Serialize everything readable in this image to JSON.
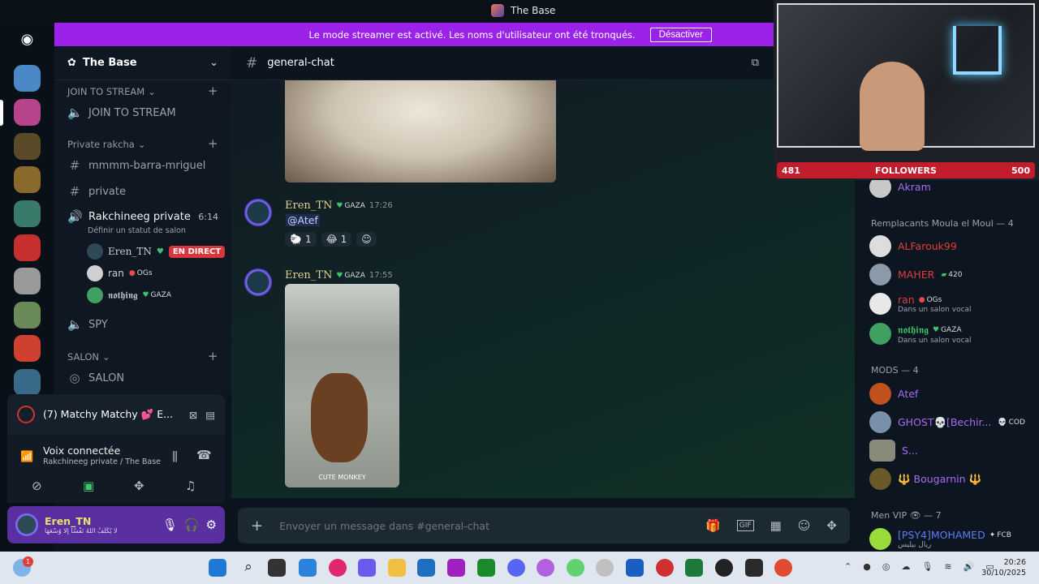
{
  "window": {
    "title": "The Base"
  },
  "banner": {
    "text": "Le mode streamer est activé. Les noms d'utilisateur ont été tronqués.",
    "button": "Désactiver"
  },
  "guild": {
    "name": "The Base"
  },
  "categories": {
    "join": "JOIN TO STREAM",
    "private": "Private rakcha",
    "salon": "SALON"
  },
  "channels": {
    "join_to_stream": "JOIN TO STREAM",
    "ch1": "mmmm-barra-mriguel",
    "ch2": "private",
    "voice_active": "Rakchineeg private",
    "voice_time": "6:14",
    "voice_status": "Définir un statut de salon",
    "spy": "SPY",
    "salon": "SALON"
  },
  "voice_users": [
    {
      "name": "Eren_TN",
      "badge": "EN DIRECT"
    },
    {
      "name": "ran",
      "tag": "OGs"
    },
    {
      "name": "𝖓𝖔𝖙𝖍𝖎𝖓𝖌",
      "tag": "GAZA"
    }
  ],
  "call": {
    "label": "(7) Matchy Matchy 💕 E..."
  },
  "voice_panel": {
    "status": "Voix connectée",
    "location": "Rakchineeg private / The Base"
  },
  "user": {
    "name": "Eren_TN",
    "status": "لَا يُكَلِّفُ اللَّهُ نَفْسًا إِلَّا وُسْعَهَا"
  },
  "chat": {
    "channel": "general-chat",
    "messages": [
      {
        "author": "Eren_TN",
        "tag": "GAZA",
        "time": "17:26",
        "text": "@Atef",
        "reactions": [
          {
            "emoji": "🐑",
            "count": "1"
          },
          {
            "emoji": "😂",
            "count": "1"
          }
        ]
      },
      {
        "author": "Eren_TN",
        "tag": "GAZA",
        "time": "17:55",
        "image_caption": "CUTE MONKEY"
      }
    ],
    "placeholder": "Envoyer un message dans #general-chat"
  },
  "overlay": {
    "followers_label": "FOLLOWERS",
    "current": "481",
    "goal": "500"
  },
  "members": {
    "top": {
      "name": "Akram"
    },
    "group1": {
      "title": "Remplacants Moula el Moul — 4",
      "items": [
        {
          "name": "ALFarouk99",
          "color": "#e03c3c"
        },
        {
          "name": "MAHER",
          "tag": "420",
          "color": "#e03c3c"
        },
        {
          "name": "ran",
          "tag": "OGs",
          "sub": "Dans un salon vocal",
          "color": "#e03c3c"
        },
        {
          "name": "𝖓𝖔𝖙𝖍𝖎𝖓𝖌",
          "tag": "GAZA",
          "sub": "Dans un salon vocal",
          "color": "#3fc46b"
        }
      ]
    },
    "group2": {
      "title": "MODS — 4",
      "items": [
        {
          "name": "Atef",
          "color": "#a66cf0"
        },
        {
          "name": "GHOST💀[Bechir...",
          "tag": "COD",
          "color": "#a66cf0"
        },
        {
          "name": "S...",
          "color": "#a66cf0"
        },
        {
          "name": "🔱 Bougarnin 🔱",
          "color": "#a66cf0"
        }
      ]
    },
    "group3": {
      "title": "Men VIP 👁 — 7",
      "items": [
        {
          "name": "[PSY4]MOHAMED",
          "tag": "FCB",
          "sub": "ريال بيليس",
          "color": "#5b7cf5"
        }
      ]
    }
  },
  "taskbar": {
    "time": "20:26",
    "date": "30/10/2025",
    "notif": "1"
  },
  "colors": {
    "accent": "#9b22e8",
    "live": "#da373c",
    "online": "#23a55a"
  }
}
